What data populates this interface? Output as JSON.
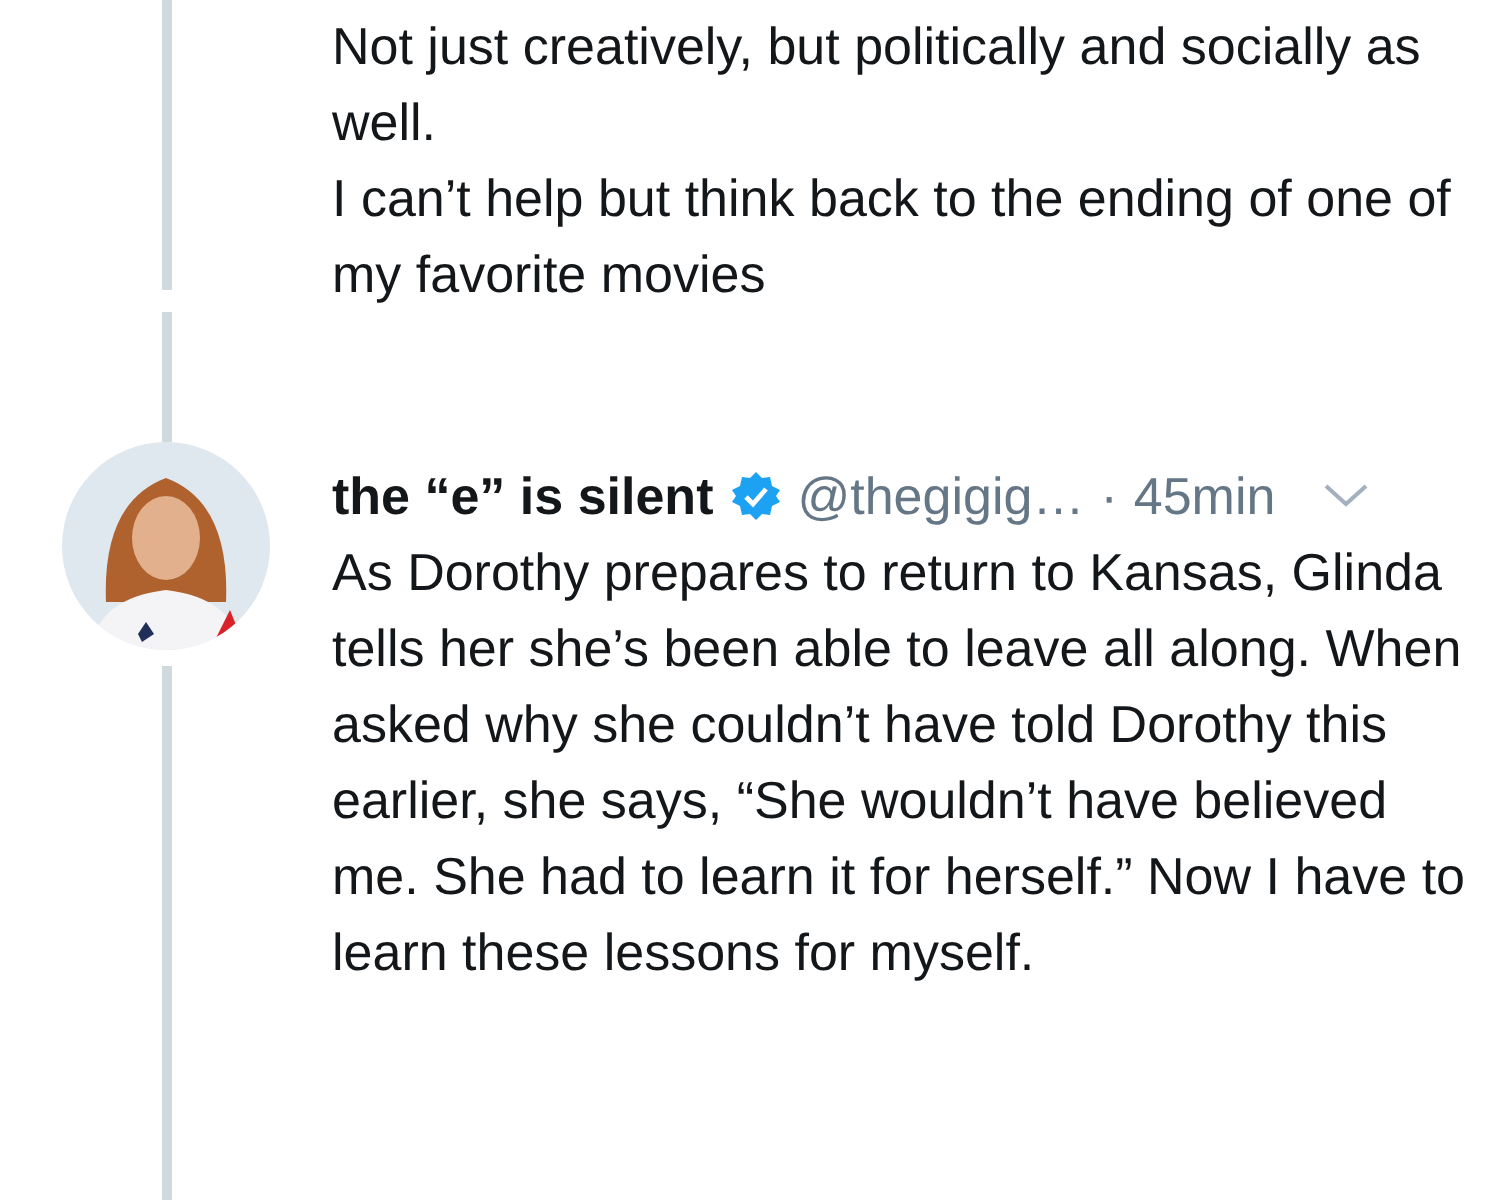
{
  "previous_tweet": {
    "paragraphs": [
      "Not just creatively, but politically and socially as well.",
      "I can’t help but think back to the ending of one of my favorite movies"
    ]
  },
  "tweet": {
    "display_name": "the “e” is silent",
    "verified": true,
    "handle": "@thegigig…",
    "separator": "·",
    "time": "45min",
    "text": "As Dorothy prepares to return to Kansas, Glinda tells her she’s been able to leave all along. When asked why she couldn’t have told Dorothy this earlier, she says, “She wouldn’t have believed me. She had to learn it for herself.” Now I have to learn these lessons for myself."
  }
}
